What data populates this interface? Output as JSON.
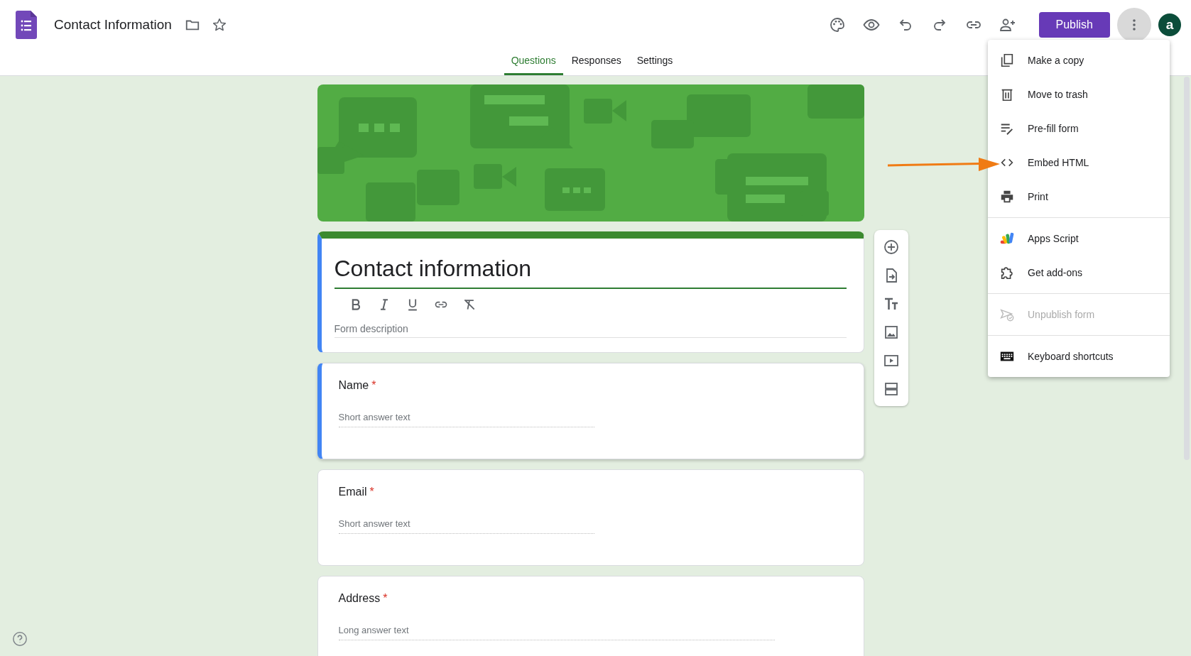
{
  "header": {
    "title": "Contact Information",
    "publish": "Publish",
    "avatar": "a"
  },
  "tabs": [
    {
      "label": "Questions",
      "selected": true
    },
    {
      "label": "Responses",
      "selected": false
    },
    {
      "label": "Settings",
      "selected": false
    }
  ],
  "form": {
    "title": "Contact information",
    "description_placeholder": "Form description"
  },
  "questions": [
    {
      "title": "Name",
      "required_mark": "*",
      "kind": "short",
      "placeholder": "Short answer text",
      "selected": true
    },
    {
      "title": "Email",
      "required_mark": "*",
      "kind": "short",
      "placeholder": "Short answer text",
      "selected": false
    },
    {
      "title": "Address",
      "required_mark": "*",
      "kind": "long",
      "placeholder": "Long answer text",
      "selected": false
    }
  ],
  "menu": {
    "sections": [
      [
        {
          "label": "Make a copy",
          "disabled": false
        },
        {
          "label": "Move to trash",
          "disabled": false
        },
        {
          "label": "Pre-fill form",
          "disabled": false
        },
        {
          "label": "Embed HTML",
          "disabled": false
        },
        {
          "label": "Print",
          "disabled": false
        }
      ],
      [
        {
          "label": "Apps Script",
          "disabled": false
        },
        {
          "label": "Get add-ons",
          "disabled": false
        }
      ],
      [
        {
          "label": "Unpublish form",
          "disabled": true
        }
      ],
      [
        {
          "label": "Keyboard shortcuts",
          "disabled": false
        }
      ]
    ]
  }
}
